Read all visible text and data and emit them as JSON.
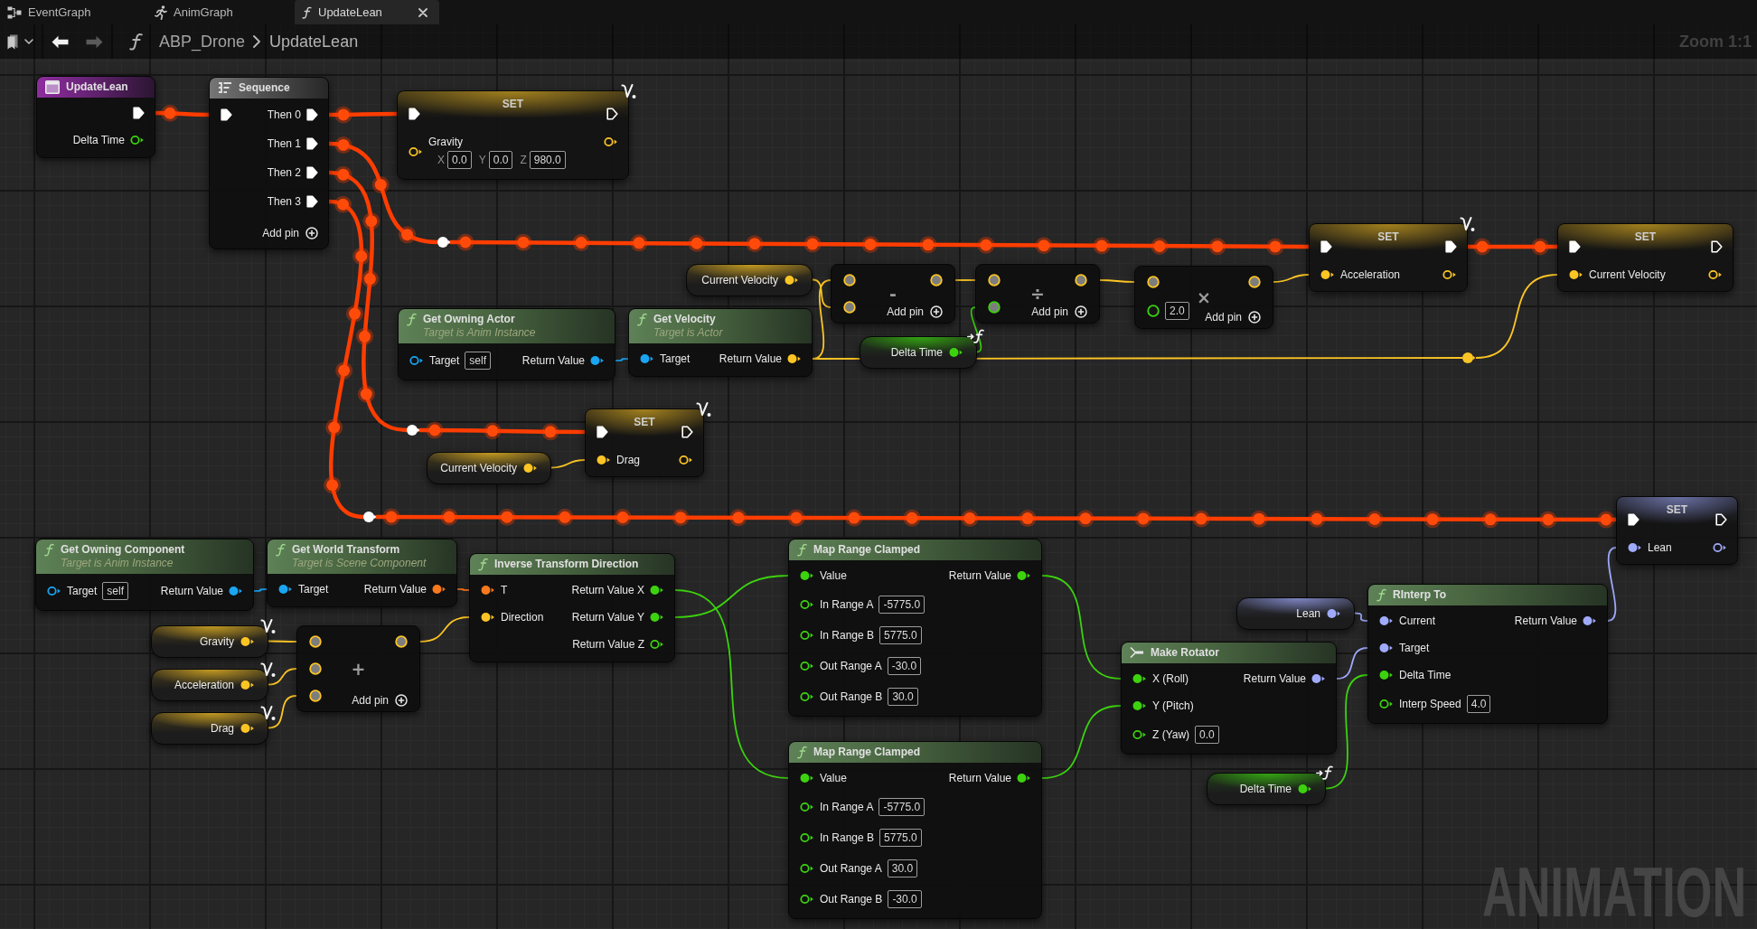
{
  "tabs": [
    {
      "label": "EventGraph",
      "kind": "event_graph",
      "selected": false
    },
    {
      "label": "AnimGraph",
      "kind": "anim_graph",
      "selected": false
    },
    {
      "label": "UpdateLean",
      "kind": "function",
      "selected": true
    }
  ],
  "toolbar": {
    "back": {
      "disabled": false
    },
    "forward": {
      "disabled": true
    },
    "breadcrumb": [
      "ABP_Drone",
      "UpdateLean"
    ],
    "zoom": "Zoom 1:1"
  },
  "graph": {
    "execution_highlighted": true,
    "watermark": "ANIMATION",
    "nodes": [
      {
        "kind": "entry",
        "title": "UpdateLean",
        "outputs": [
          {
            "kind": "exec",
            "connected": true
          },
          {
            "label": "Delta Time",
            "kind": "float",
            "connected": false
          }
        ]
      },
      {
        "kind": "sequence",
        "title": "Sequence",
        "inputs": [
          {
            "kind": "exec",
            "connected": true
          }
        ],
        "outputs": [
          {
            "label": "Then 0",
            "kind": "exec",
            "connected": true
          },
          {
            "label": "Then 1",
            "kind": "exec",
            "connected": true
          },
          {
            "label": "Then 2",
            "kind": "exec",
            "connected": true
          },
          {
            "label": "Then 3",
            "kind": "exec",
            "connected": true
          }
        ],
        "add_pin": "Add pin"
      },
      {
        "kind": "set",
        "title": "SET",
        "badge": {
          "kind": "variable"
        },
        "inputs": [
          {
            "kind": "exec",
            "connected": true
          },
          {
            "label": "Gravity",
            "kind": "vector",
            "connected": false,
            "fields": [
              {
                "axis": "X",
                "value": "0.0"
              },
              {
                "axis": "Y",
                "value": "0.0"
              },
              {
                "axis": "Z",
                "value": "980.0"
              }
            ]
          }
        ],
        "outputs": [
          {
            "kind": "exec",
            "connected": false
          },
          {
            "kind": "vector",
            "connected": false
          }
        ]
      },
      {
        "kind": "reroute",
        "outputs": [
          {
            "kind": "exec"
          }
        ]
      },
      {
        "kind": "function",
        "title": "Get Owning Actor",
        "subtitle": "Target is Anim Instance",
        "inputs": [
          {
            "label": "Target",
            "kind": "object",
            "connected": false,
            "value": "self"
          }
        ],
        "outputs": [
          {
            "label": "Return Value",
            "kind": "object",
            "connected": true
          }
        ]
      },
      {
        "kind": "getter",
        "title": "Current Velocity",
        "outputs": [
          {
            "kind": "vector",
            "connected": true
          }
        ]
      },
      {
        "kind": "function",
        "title": "Get Velocity",
        "subtitle": "Target is Actor",
        "inputs": [
          {
            "label": "Target",
            "kind": "object",
            "connected": true
          }
        ],
        "outputs": [
          {
            "label": "Return Value",
            "kind": "vector",
            "connected": true
          }
        ]
      },
      {
        "kind": "math",
        "symbol": "-",
        "inputs": [
          {
            "kind": "vector",
            "connected": true
          },
          {
            "kind": "vector",
            "connected": true
          }
        ],
        "outputs": [
          {
            "kind": "vector",
            "connected": true
          }
        ],
        "add_pin": "Add pin"
      },
      {
        "kind": "math",
        "symbol": "÷",
        "inputs": [
          {
            "kind": "vector",
            "connected": true
          },
          {
            "kind": "float",
            "connected": true
          }
        ],
        "outputs": [
          {
            "kind": "vector",
            "connected": true
          }
        ],
        "add_pin": "Add pin"
      },
      {
        "kind": "getter",
        "title": "Delta Time",
        "badge": {
          "kind": "parameter"
        },
        "outputs": [
          {
            "kind": "float",
            "connected": true
          }
        ]
      },
      {
        "kind": "math",
        "symbol": "×",
        "inputs": [
          {
            "kind": "vector",
            "connected": true
          },
          {
            "kind": "float",
            "connected": false,
            "value": "2.0"
          }
        ],
        "outputs": [
          {
            "kind": "vector",
            "connected": true
          }
        ],
        "add_pin": "Add pin"
      },
      {
        "kind": "set",
        "title": "SET",
        "badge": {
          "kind": "variable"
        },
        "inputs": [
          {
            "kind": "exec",
            "connected": true
          },
          {
            "label": "Acceleration",
            "kind": "vector",
            "connected": true
          }
        ],
        "outputs": [
          {
            "kind": "exec",
            "connected": true
          },
          {
            "kind": "vector",
            "connected": false
          }
        ]
      },
      {
        "kind": "set",
        "title": "SET",
        "inputs": [
          {
            "kind": "exec",
            "connected": true
          },
          {
            "label": "Current Velocity",
            "kind": "vector",
            "connected": true
          }
        ],
        "outputs": [
          {
            "kind": "exec",
            "connected": false
          },
          {
            "kind": "vector",
            "connected": false
          }
        ]
      },
      {
        "kind": "reroute",
        "outputs": [
          {
            "kind": "vector"
          }
        ]
      },
      {
        "kind": "reroute",
        "outputs": [
          {
            "kind": "exec"
          }
        ]
      },
      {
        "kind": "getter",
        "title": "Current Velocity",
        "outputs": [
          {
            "kind": "vector",
            "connected": true
          }
        ]
      },
      {
        "kind": "set",
        "title": "SET",
        "badge": {
          "kind": "variable"
        },
        "inputs": [
          {
            "kind": "exec",
            "connected": true
          },
          {
            "label": "Drag",
            "kind": "vector",
            "connected": true
          }
        ],
        "outputs": [
          {
            "kind": "exec",
            "connected": false
          },
          {
            "kind": "vector",
            "connected": false
          }
        ]
      },
      {
        "kind": "reroute",
        "outputs": [
          {
            "kind": "exec"
          }
        ]
      },
      {
        "kind": "function",
        "title": "Get Owning Component",
        "subtitle": "Target is Anim Instance",
        "inputs": [
          {
            "label": "Target",
            "kind": "object",
            "connected": false,
            "value": "self"
          }
        ],
        "outputs": [
          {
            "label": "Return Value",
            "kind": "object",
            "connected": true
          }
        ]
      },
      {
        "kind": "function",
        "title": "Get World Transform",
        "subtitle": "Target is Scene Component",
        "inputs": [
          {
            "label": "Target",
            "kind": "object",
            "connected": true
          }
        ],
        "outputs": [
          {
            "label": "Return Value",
            "kind": "transform",
            "connected": true
          }
        ]
      },
      {
        "kind": "getter",
        "title": "Gravity",
        "badge": {
          "kind": "variable"
        },
        "outputs": [
          {
            "kind": "vector",
            "connected": true
          }
        ]
      },
      {
        "kind": "getter",
        "title": "Acceleration",
        "badge": {
          "kind": "variable"
        },
        "outputs": [
          {
            "kind": "vector",
            "connected": true
          }
        ]
      },
      {
        "kind": "getter",
        "title": "Drag",
        "badge": {
          "kind": "variable"
        },
        "outputs": [
          {
            "kind": "vector",
            "connected": true
          }
        ]
      },
      {
        "kind": "math",
        "symbol": "+",
        "inputs": [
          {
            "kind": "vector",
            "connected": true
          },
          {
            "kind": "vector",
            "connected": true
          },
          {
            "kind": "vector",
            "connected": true
          }
        ],
        "outputs": [
          {
            "kind": "vector",
            "connected": true
          }
        ],
        "add_pin": "Add pin"
      },
      {
        "kind": "function",
        "title": "Inverse Transform Direction",
        "inputs": [
          {
            "label": "T",
            "kind": "transform",
            "connected": true
          },
          {
            "label": "Direction",
            "kind": "vector",
            "connected": true
          }
        ],
        "outputs": [
          {
            "label": "Return Value X",
            "kind": "float",
            "connected": true
          },
          {
            "label": "Return Value Y",
            "kind": "float",
            "connected": true
          },
          {
            "label": "Return Value Z",
            "kind": "float",
            "connected": false
          }
        ]
      },
      {
        "kind": "function",
        "title": "Map Range Clamped",
        "inputs": [
          {
            "label": "Value",
            "kind": "float",
            "connected": true
          },
          {
            "label": "In Range A",
            "kind": "float",
            "connected": false,
            "value": "-5775.0"
          },
          {
            "label": "In Range B",
            "kind": "float",
            "connected": false,
            "value": "5775.0"
          },
          {
            "label": "Out Range A",
            "kind": "float",
            "connected": false,
            "value": "-30.0"
          },
          {
            "label": "Out Range B",
            "kind": "float",
            "connected": false,
            "value": "30.0"
          }
        ],
        "outputs": [
          {
            "label": "Return Value",
            "kind": "float",
            "connected": true
          }
        ]
      },
      {
        "kind": "set",
        "title": "SET",
        "inputs": [
          {
            "kind": "exec",
            "connected": true
          },
          {
            "label": "Lean",
            "kind": "rotator",
            "connected": true
          }
        ],
        "outputs": [
          {
            "kind": "exec",
            "connected": false
          },
          {
            "kind": "rotator",
            "connected": false
          }
        ]
      },
      {
        "kind": "function",
        "title": "Map Range Clamped",
        "inputs": [
          {
            "label": "Value",
            "kind": "float",
            "connected": true
          },
          {
            "label": "In Range A",
            "kind": "float",
            "connected": false,
            "value": "-5775.0"
          },
          {
            "label": "In Range B",
            "kind": "float",
            "connected": false,
            "value": "5775.0"
          },
          {
            "label": "Out Range A",
            "kind": "float",
            "connected": false,
            "value": "30.0"
          },
          {
            "label": "Out Range B",
            "kind": "float",
            "connected": false,
            "value": "-30.0"
          }
        ],
        "outputs": [
          {
            "label": "Return Value",
            "kind": "float",
            "connected": true
          }
        ]
      },
      {
        "kind": "getter",
        "title": "Lean",
        "outputs": [
          {
            "kind": "rotator",
            "connected": true
          }
        ]
      },
      {
        "kind": "struct",
        "title": "Make Rotator",
        "inputs": [
          {
            "label": "X (Roll)",
            "kind": "float",
            "connected": true
          },
          {
            "label": "Y (Pitch)",
            "kind": "float",
            "connected": true
          },
          {
            "label": "Z (Yaw)",
            "kind": "float",
            "connected": false,
            "value": "0.0"
          }
        ],
        "outputs": [
          {
            "label": "Return Value",
            "kind": "rotator",
            "connected": true
          }
        ]
      },
      {
        "kind": "function",
        "title": "RInterp To",
        "inputs": [
          {
            "label": "Current",
            "kind": "rotator",
            "connected": true
          },
          {
            "label": "Target",
            "kind": "rotator",
            "connected": true
          },
          {
            "label": "Delta Time",
            "kind": "float",
            "connected": true
          },
          {
            "label": "Interp Speed",
            "kind": "float",
            "connected": false,
            "value": "4.0"
          }
        ],
        "outputs": [
          {
            "label": "Return Value",
            "kind": "rotator",
            "connected": true
          }
        ]
      },
      {
        "kind": "getter",
        "title": "Delta Time",
        "badge": {
          "kind": "parameter"
        },
        "outputs": [
          {
            "kind": "float",
            "connected": true
          }
        ]
      }
    ]
  }
}
